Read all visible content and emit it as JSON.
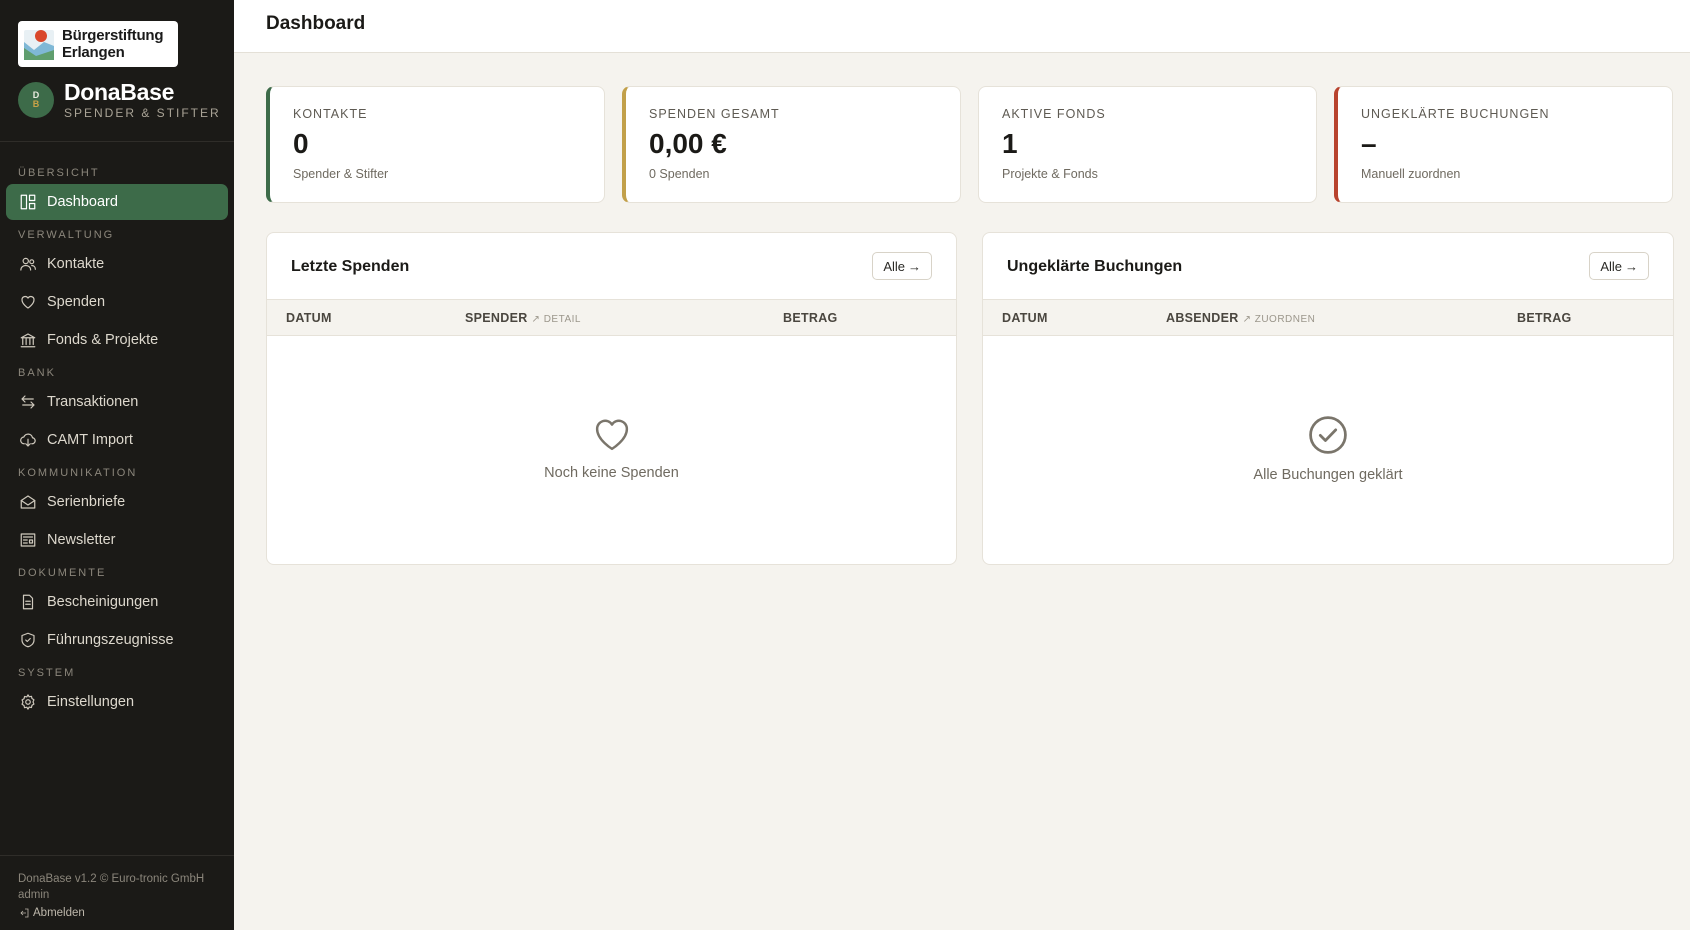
{
  "org": {
    "name_line1": "Bürgerstiftung",
    "name_line2": "Erlangen"
  },
  "brand": {
    "avatar_top": "D",
    "avatar_bottom": "B",
    "name": "DonaBase",
    "subtitle": "SPENDER & STIFTER"
  },
  "nav": [
    {
      "section": "ÜBERSICHT",
      "items": [
        {
          "label": "Dashboard",
          "icon": "dashboard-icon",
          "active": true
        }
      ]
    },
    {
      "section": "VERWALTUNG",
      "items": [
        {
          "label": "Kontakte",
          "icon": "users-icon"
        },
        {
          "label": "Spenden",
          "icon": "heart-icon"
        },
        {
          "label": "Fonds & Projekte",
          "icon": "bank-icon"
        }
      ]
    },
    {
      "section": "BANK",
      "items": [
        {
          "label": "Transaktionen",
          "icon": "transfer-icon"
        },
        {
          "label": "CAMT Import",
          "icon": "cloud-download-icon"
        }
      ]
    },
    {
      "section": "KOMMUNIKATION",
      "items": [
        {
          "label": "Serienbriefe",
          "icon": "mail-icon"
        },
        {
          "label": "Newsletter",
          "icon": "newspaper-icon"
        }
      ]
    },
    {
      "section": "DOKUMENTE",
      "items": [
        {
          "label": "Bescheinigungen",
          "icon": "document-icon"
        },
        {
          "label": "Führungszeugnisse",
          "icon": "shield-icon"
        }
      ]
    },
    {
      "section": "SYSTEM",
      "items": [
        {
          "label": "Einstellungen",
          "icon": "gear-icon"
        }
      ]
    }
  ],
  "footer": {
    "version": "DonaBase v1.2 © Euro-tronic GmbH",
    "user": "admin",
    "logout": "Abmelden"
  },
  "header": {
    "title": "Dashboard"
  },
  "stats": [
    {
      "label": "KONTAKTE",
      "value": "0",
      "sub": "Spender & Stifter",
      "color": "#3d6b49"
    },
    {
      "label": "SPENDEN GESAMT",
      "value": "0,00 €",
      "sub": "0 Spenden",
      "color": "#c2a04a"
    },
    {
      "label": "AKTIVE FONDS",
      "value": "1",
      "sub": "Projekte & Fonds",
      "color": "#e6e2d9"
    },
    {
      "label": "UNGEKLÄRTE BUCHUNGEN",
      "value": "–",
      "sub": "Manuell zuordnen",
      "color": "#b8432e"
    }
  ],
  "panels": {
    "donations": {
      "title": "Letzte Spenden",
      "button": "Alle",
      "columns": {
        "date": "DATUM",
        "donor": "SPENDER",
        "donor_hint": "↗ DETAIL",
        "amount": "BETRAG"
      },
      "empty": "Noch keine Spenden"
    },
    "unresolved": {
      "title": "Ungeklärte Buchungen",
      "button": "Alle",
      "columns": {
        "date": "DATUM",
        "sender": "ABSENDER",
        "sender_hint": "↗ ZUORDNEN",
        "amount": "BETRAG"
      },
      "empty": "Alle Buchungen geklärt"
    }
  }
}
